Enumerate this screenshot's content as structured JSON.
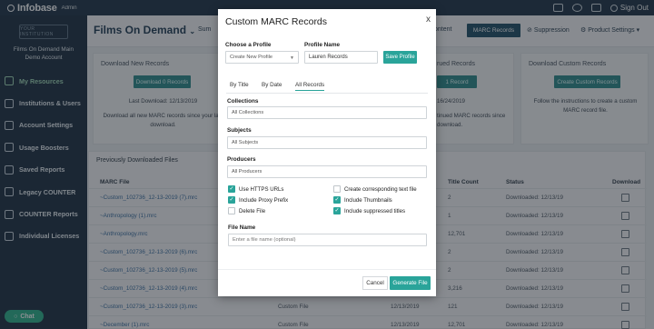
{
  "topbar": {
    "brand": "Infobase",
    "admin": "Admin",
    "signout": "Sign Out"
  },
  "sidebar": {
    "inst_logo": "YOUR INSTITUTION",
    "inst_name": "Films On Demand Main Demo Account",
    "items": [
      {
        "label": "My Resources",
        "icon": "book-icon",
        "active": true
      },
      {
        "label": "Institutions & Users",
        "icon": "users-icon"
      },
      {
        "label": "Account Settings",
        "icon": "gear-icon"
      },
      {
        "label": "Usage Boosters",
        "icon": "rocket-icon"
      },
      {
        "label": "Saved Reports",
        "icon": "report-icon"
      },
      {
        "label": "Legacy COUNTER",
        "icon": "counter-icon"
      },
      {
        "label": "COUNTER Reports",
        "icon": "chart-icon"
      },
      {
        "label": "Individual Licenses",
        "icon": "license-icon"
      }
    ],
    "chat": "Chat"
  },
  "header": {
    "title": "Films On Demand",
    "sum": "Sum",
    "content": "ontent",
    "marc": "MARC Records",
    "suppression": "Suppression",
    "product_settings": "Product Settings"
  },
  "panels": {
    "new": {
      "title": "Download New Records",
      "button": "Download 0 Records",
      "date_label": "Last Download: 12/13/2019",
      "desc": "Download all new MARC records since your last download."
    },
    "updated": {
      "title": "rued Records",
      "button": "1 Record",
      "date_label": "16/24/2019",
      "desc": "tinued MARC records since download."
    },
    "custom": {
      "title": "Download Custom Records",
      "button": "Create Custom Records",
      "desc": "Follow the instructions to create a custom MARC record file."
    }
  },
  "table": {
    "title": "Previously Downloaded Files",
    "headers": {
      "file": "MARC File",
      "title_count": "Title Count",
      "status": "Status",
      "download": "Download"
    },
    "rows": [
      {
        "file": "~Custom_102736_12-13-2019 (7).mrc",
        "type": "",
        "date": "",
        "count": "2",
        "status": "Downloaded: 12/13/19"
      },
      {
        "file": "~Anthropology (1).mrc",
        "type": "",
        "date": "",
        "count": "1",
        "status": "Downloaded: 12/13/19"
      },
      {
        "file": "~Anthropology.mrc",
        "type": "",
        "date": "",
        "count": "12,701",
        "status": "Downloaded: 12/13/19"
      },
      {
        "file": "~Custom_102736_12-13-2019 (6).mrc",
        "type": "",
        "date": "",
        "count": "2",
        "status": "Downloaded: 12/13/19"
      },
      {
        "file": "~Custom_102736_12-13-2019 (5).mrc",
        "type": "",
        "date": "",
        "count": "2",
        "status": "Downloaded: 12/13/19"
      },
      {
        "file": "~Custom_102736_12-13-2019 (4).mrc",
        "type": "",
        "date": "",
        "count": "3,216",
        "status": "Downloaded: 12/13/19"
      },
      {
        "file": "~Custom_102736_12-13-2019 (3).mrc",
        "type": "Custom File",
        "date": "12/13/2019",
        "count": "121",
        "status": "Downloaded: 12/13/19"
      },
      {
        "file": "~December (1).mrc",
        "type": "Custom File",
        "date": "12/13/2019",
        "count": "12,701",
        "status": "Downloaded: 12/13/19"
      }
    ]
  },
  "modal": {
    "title": "Custom MARC Records",
    "close": "x",
    "profile_label": "Choose a Profile",
    "profile_value": "Create New Profile",
    "profile_name_label": "Profile Name",
    "profile_name_value": "Lauren Records",
    "save_profile": "Save Profile",
    "tabs": [
      "By Title",
      "By Date",
      "All Records"
    ],
    "collections_label": "Collections",
    "collections_value": "All Collections",
    "subjects_label": "Subjects",
    "subjects_value": "All Subjects",
    "producers_label": "Producers",
    "producers_value": "All Producers",
    "options": [
      {
        "label": "Use HTTPS URLs",
        "checked": true
      },
      {
        "label": "Create corresponding text file",
        "checked": false
      },
      {
        "label": "Include Proxy Prefix",
        "checked": true
      },
      {
        "label": "Include Thumbnails",
        "checked": true
      },
      {
        "label": "Delete File",
        "checked": false
      },
      {
        "label": "Include suppressed titles",
        "checked": true
      }
    ],
    "file_name_label": "File Name",
    "file_name_placeholder": "Enter a file name (optional)",
    "cancel": "Cancel",
    "generate": "Generate File"
  }
}
